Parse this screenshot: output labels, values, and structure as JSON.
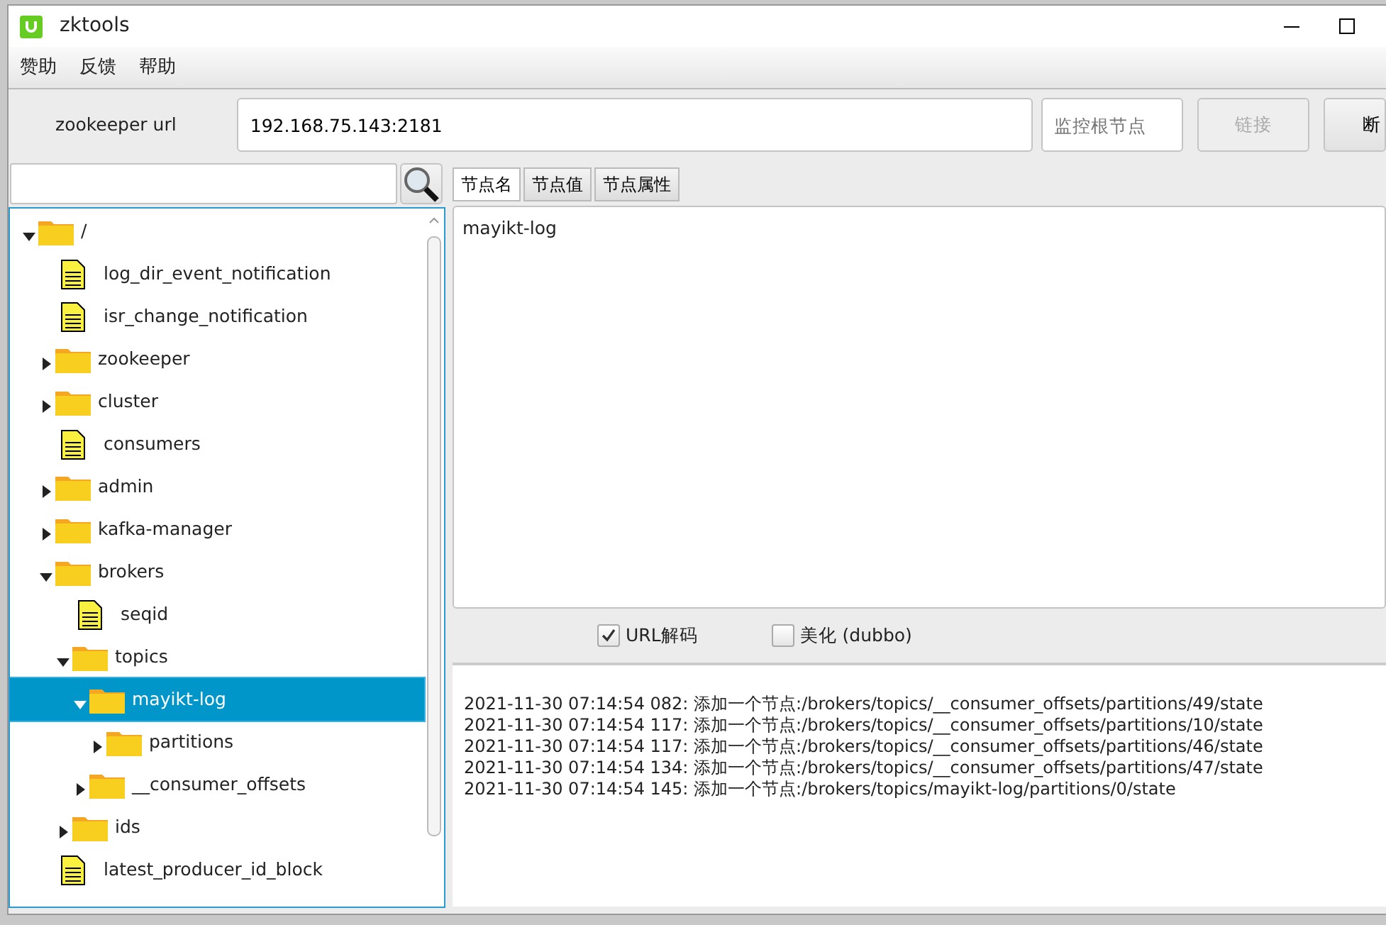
{
  "window": {
    "title": "zktools"
  },
  "menu": [
    "赞助",
    "反馈",
    "帮助"
  ],
  "toolbar": {
    "url_label": "zookeeper url",
    "url_value": "192.168.75.143:2181",
    "root_placeholder": "监控根节点",
    "buttons": [
      {
        "label": "链接",
        "disabled": true
      },
      {
        "label": "断",
        "disabled": false
      }
    ]
  },
  "tree": [
    {
      "label": "/",
      "kind": "folder",
      "expanded": true,
      "selected": false,
      "children": [
        {
          "label": "log_dir_event_notification",
          "kind": "file",
          "selected": false
        },
        {
          "label": "isr_change_notification",
          "kind": "file",
          "selected": false
        },
        {
          "label": "zookeeper",
          "kind": "folder",
          "expanded": false,
          "selected": false
        },
        {
          "label": "cluster",
          "kind": "folder",
          "expanded": false,
          "selected": false
        },
        {
          "label": "consumers",
          "kind": "file",
          "selected": false
        },
        {
          "label": "admin",
          "kind": "folder",
          "expanded": false,
          "selected": false
        },
        {
          "label": "kafka-manager",
          "kind": "folder",
          "expanded": false,
          "selected": false
        },
        {
          "label": "brokers",
          "kind": "folder",
          "expanded": true,
          "selected": false,
          "children": [
            {
              "label": "seqid",
              "kind": "file",
              "selected": false
            },
            {
              "label": "topics",
              "kind": "folder",
              "expanded": true,
              "selected": false,
              "children": [
                {
                  "label": "mayikt-log",
                  "kind": "folder",
                  "expanded": true,
                  "selected": true,
                  "children": [
                    {
                      "label": "partitions",
                      "kind": "folder",
                      "expanded": false,
                      "selected": false
                    }
                  ]
                },
                {
                  "label": "__consumer_offsets",
                  "kind": "folder",
                  "expanded": false,
                  "selected": false
                }
              ]
            },
            {
              "label": "ids",
              "kind": "folder",
              "expanded": false,
              "selected": false
            }
          ]
        },
        {
          "label": "latest_producer_id_block",
          "kind": "file",
          "selected": false
        }
      ]
    }
  ],
  "tabs": [
    {
      "label": "节点名",
      "selected": true
    },
    {
      "label": "节点值",
      "selected": false
    },
    {
      "label": "节点属性",
      "selected": false
    }
  ],
  "node_text": "mayikt-log",
  "options": [
    {
      "label": "URL解码",
      "checked": true
    },
    {
      "label": "美化 (dubbo)",
      "checked": false
    }
  ],
  "log": [
    "2021-11-30 07:14:54 082: 添加一个节点:/brokers/topics/__consumer_offsets/partitions/49/state",
    "2021-11-30 07:14:54 117: 添加一个节点:/brokers/topics/__consumer_offsets/partitions/10/state",
    "2021-11-30 07:14:54 117: 添加一个节点:/brokers/topics/__consumer_offsets/partitions/46/state",
    "2021-11-30 07:14:54 134: 添加一个节点:/brokers/topics/__consumer_offsets/partitions/47/state",
    "2021-11-30 07:14:54 145: 添加一个节点:/brokers/topics/mayikt-log/partitions/0/state"
  ]
}
